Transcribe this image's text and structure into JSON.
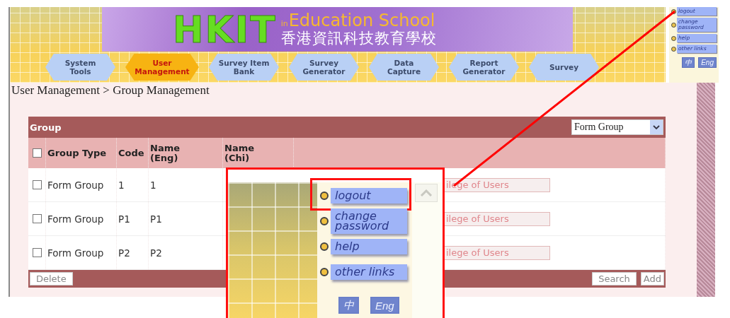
{
  "banner": {
    "logo_main": "HKIT",
    "logo_prefix": "in",
    "logo_title": "Education School",
    "logo_chinese": "香港資訊科技教育學校"
  },
  "tabs": [
    {
      "label": "System Tools",
      "selected": false
    },
    {
      "label": "User Management",
      "selected": true
    },
    {
      "label": "Survey Item Bank",
      "selected": false
    },
    {
      "label": "Survey Generator",
      "selected": false
    },
    {
      "label": "Data Capture",
      "selected": false
    },
    {
      "label": "Report Generator",
      "selected": false
    },
    {
      "label": "Survey",
      "selected": false
    }
  ],
  "top_links": [
    {
      "label": "logout"
    },
    {
      "label": "change password"
    },
    {
      "label": "help"
    },
    {
      "label": "other links"
    }
  ],
  "language_buttons": [
    "中",
    "Eng"
  ],
  "breadcrumb": "User Management > Group Management",
  "table": {
    "title": "Group",
    "filter": {
      "value": "Form Group"
    },
    "select_all": {
      "checked": false
    },
    "columns": [
      "Group Type",
      "Code",
      "Name (Eng)",
      "Name (Chi)"
    ],
    "rows": [
      {
        "checked": false,
        "group_type": "Form Group",
        "code": "1",
        "name_eng": "1",
        "action": "ilege of Users"
      },
      {
        "checked": false,
        "group_type": "Form Group",
        "code": "P1",
        "name_eng": "P1",
        "action": "ilege of Users"
      },
      {
        "checked": false,
        "group_type": "Form Group",
        "code": "P2",
        "name_eng": "P2",
        "action": "ilege of Users"
      }
    ],
    "footer_buttons": {
      "left": [
        "Delete"
      ],
      "right": [
        "Search",
        "Add"
      ]
    }
  },
  "callout": {
    "links": [
      {
        "label": "logout",
        "highlighted": true
      },
      {
        "label": "change password",
        "highlighted": false
      },
      {
        "label": "help",
        "highlighted": false
      },
      {
        "label": "other links",
        "highlighted": false
      }
    ],
    "language_buttons": [
      "中",
      "Eng"
    ]
  }
}
